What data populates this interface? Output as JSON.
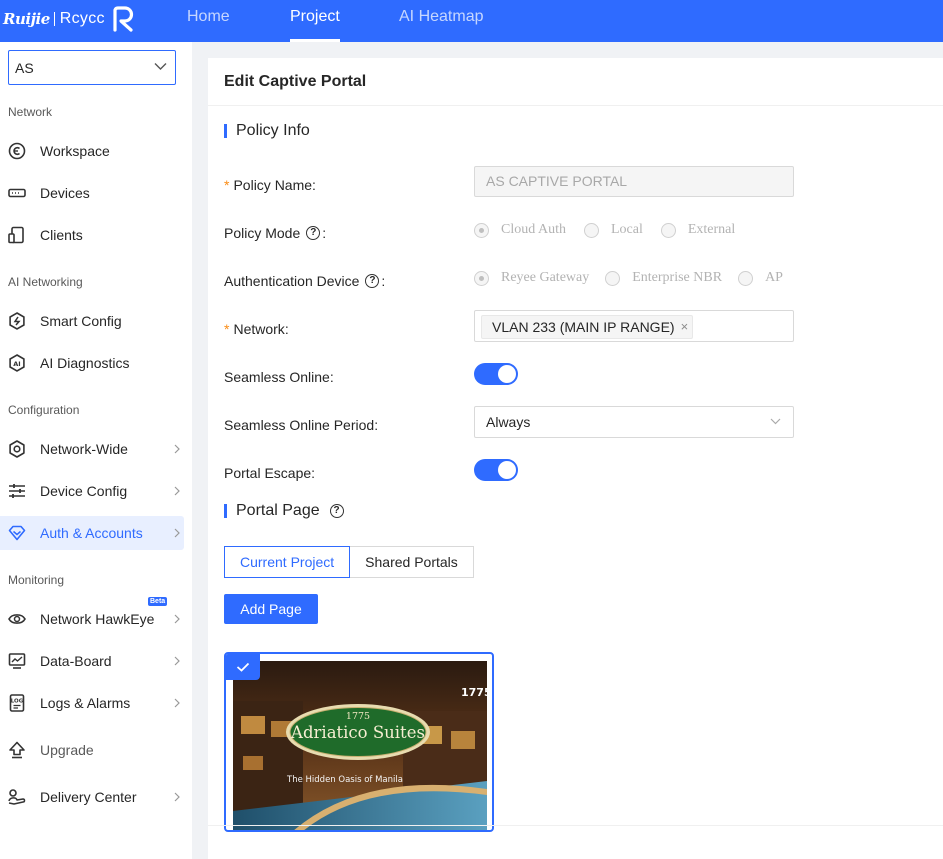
{
  "brand": {
    "ruijie": "Ruijie",
    "reyee": "Rcycc"
  },
  "topnav": {
    "home": "Home",
    "project": "Project",
    "heatmap": "AI Heatmap"
  },
  "sidebar": {
    "project_select": "AS",
    "sections": {
      "network": "Network",
      "ai_networking": "AI Networking",
      "configuration": "Configuration",
      "monitoring": "Monitoring"
    },
    "items": {
      "workspace": "Workspace",
      "devices": "Devices",
      "clients": "Clients",
      "smart_config": "Smart Config",
      "ai_diagnostics": "AI Diagnostics",
      "network_wide": "Network-Wide",
      "device_config": "Device Config",
      "auth_accounts": "Auth & Accounts",
      "network_hawkeye": "Network HawkEye",
      "beta": "Beta",
      "data_board": "Data-Board",
      "logs_alarms": "Logs & Alarms",
      "upgrade": "Upgrade",
      "delivery_center": "Delivery Center"
    },
    "active_color": "#2f6bff"
  },
  "page": {
    "title": "Edit Captive Portal",
    "policy_info": {
      "heading": "Policy Info",
      "policy_name_label": "Policy Name",
      "policy_name_value": "AS CAPTIVE PORTAL",
      "policy_mode_label": "Policy Mode",
      "policy_mode_options": [
        "Cloud Auth",
        "Local",
        "External"
      ],
      "policy_mode_selected": "Cloud Auth",
      "auth_device_label": "Authentication Device",
      "auth_device_options": [
        "Reyee Gateway",
        "Enterprise NBR",
        "AP"
      ],
      "auth_device_selected": "Reyee Gateway",
      "network_label": "Network",
      "network_tag": "VLAN 233 (MAIN IP RANGE)",
      "seamless_online_label": "Seamless Online",
      "seamless_online_on": true,
      "seamless_period_label": "Seamless Online Period",
      "seamless_period_value": "Always",
      "portal_escape_label": "Portal Escape",
      "portal_escape_on": true,
      "colon": ":",
      "required_mark": "*"
    },
    "portal_page": {
      "heading": "Portal Page",
      "tabs": [
        "Current Project",
        "Shared Portals"
      ],
      "selected_tab": "Current Project",
      "add_button": "Add Page",
      "card": {
        "logo_year": "1775",
        "logo_name": "Adriatico Suites",
        "tagline": "The Hidden Oasis of Manila",
        "corner_text": "1775"
      }
    }
  }
}
